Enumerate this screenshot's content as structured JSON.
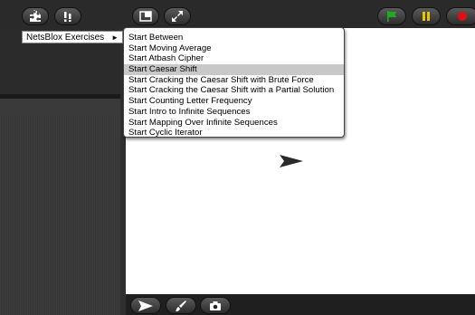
{
  "topbar": {
    "icons": [
      "puzzle-icon",
      "alert-icon",
      "stage-layout-icon",
      "fullscreen-icon",
      "green-flag-icon",
      "pause-icon",
      "stop-icon"
    ],
    "colors": {
      "flag": "#22aa22",
      "pause": "#e6c400",
      "stop": "#e01010"
    }
  },
  "library_menu": {
    "label": "NetsBlox Exercises",
    "arrow": "►"
  },
  "exercise_menu": {
    "items": [
      "Start Between",
      "Start Moving Average",
      "Start Atbash Cipher",
      "Start Caesar Shift",
      "Start Cracking the Caesar Shift with Brute Force",
      "Start Cracking the Caesar Shift with a Partial Solution",
      "Start Counting Letter Frequency",
      "Start Intro to Infinite Sequences",
      "Start Mapping Over Infinite Sequences",
      "Start Cyclic Iterator"
    ],
    "highlighted_index": 3
  },
  "palette_toolbar": {
    "icons": [
      "undo-icon",
      "redo-icon",
      "keyboard-icon"
    ]
  },
  "stage_toolbar": {
    "icons": [
      "turtle-icon",
      "paint-brush-icon",
      "camera-icon"
    ]
  }
}
